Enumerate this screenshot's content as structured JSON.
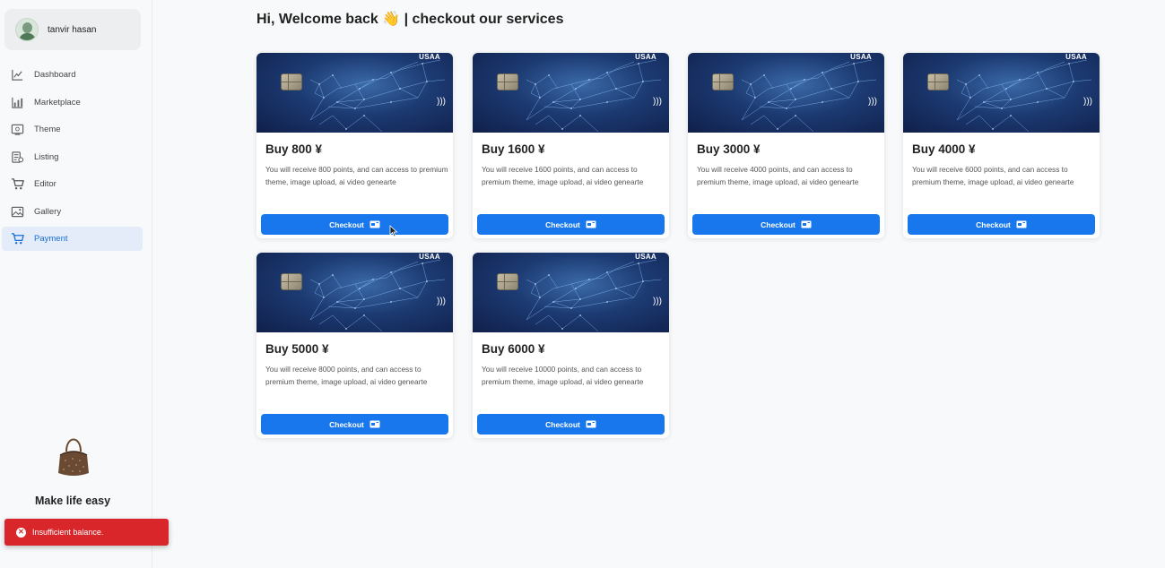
{
  "user": {
    "name": "tanvir hasan"
  },
  "sidebar": {
    "items": [
      {
        "label": "Dashboard",
        "icon": "chart-line-icon",
        "active": false
      },
      {
        "label": "Marketplace",
        "icon": "chart-bar-icon",
        "active": false
      },
      {
        "label": "Theme",
        "icon": "theme-icon",
        "active": false
      },
      {
        "label": "Listing",
        "icon": "listing-icon",
        "active": false
      },
      {
        "label": "Editor",
        "icon": "cart-icon",
        "active": false
      },
      {
        "label": "Gallery",
        "icon": "gallery-icon",
        "active": false
      },
      {
        "label": "Payment",
        "icon": "cart-icon",
        "active": true
      }
    ],
    "promo_text": "Make life easy"
  },
  "header": {
    "title": "Hi, Welcome back 👋 | checkout our services"
  },
  "cards": [
    {
      "brand": "USAA",
      "title": "Buy 800 ¥",
      "description": "You will receive 800 points, and can access to premium theme, image upload, ai video genearte",
      "button": "Checkout"
    },
    {
      "brand": "USAA",
      "title": "Buy 1600 ¥",
      "description": "You will receive 1600 points, and can access to premium theme, image upload, ai video genearte",
      "button": "Checkout"
    },
    {
      "brand": "USAA",
      "title": "Buy 3000 ¥",
      "description": "You will receive 4000 points, and can access to premium theme, image upload, ai video genearte",
      "button": "Checkout"
    },
    {
      "brand": "USAA",
      "title": "Buy 4000 ¥",
      "description": "You will receive 6000 points, and can access to premium theme, image upload, ai video genearte",
      "button": "Checkout"
    },
    {
      "brand": "USAA",
      "title": "Buy 5000 ¥",
      "description": "You will receive 8000 points, and can access to premium theme, image upload, ai video genearte",
      "button": "Checkout"
    },
    {
      "brand": "USAA",
      "title": "Buy 6000 ¥",
      "description": "You will receive 10000 points, and can access to premium theme, image upload, ai video genearte",
      "button": "Checkout"
    }
  ],
  "toast": {
    "message": "Insufficient balance.",
    "type": "error"
  },
  "colors": {
    "primary": "#1877ec",
    "error": "#d8262b",
    "active_nav_bg": "#e3ecf8"
  }
}
